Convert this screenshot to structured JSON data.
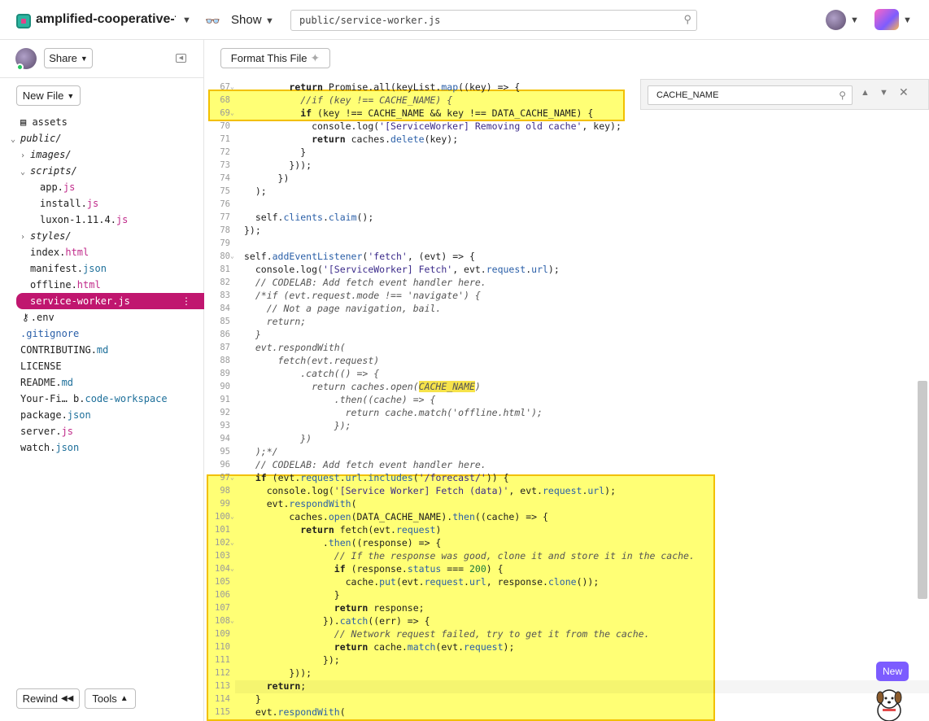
{
  "header": {
    "project_name": "amplified-cooperative-t…",
    "show_label": "Show",
    "url": "public/service-worker.js"
  },
  "sidebar": {
    "share_label": "Share",
    "new_file_label": "New File",
    "rewind_label": "Rewind",
    "tools_label": "Tools",
    "tree": [
      {
        "name": "assets",
        "ext": "",
        "indent": 0,
        "kind": "assets"
      },
      {
        "name": "public/",
        "ext": "",
        "indent": 0,
        "kind": "folder-open"
      },
      {
        "name": "images/",
        "ext": "",
        "indent": 1,
        "kind": "folder-closed"
      },
      {
        "name": "scripts/",
        "ext": "",
        "indent": 1,
        "kind": "folder-open"
      },
      {
        "name": "app.",
        "ext": "js",
        "indent": 2,
        "kind": "file"
      },
      {
        "name": "install.",
        "ext": "js",
        "indent": 2,
        "kind": "file"
      },
      {
        "name": "luxon-1.11.4.",
        "ext": "js",
        "indent": 2,
        "kind": "file"
      },
      {
        "name": "styles/",
        "ext": "",
        "indent": 1,
        "kind": "folder-closed"
      },
      {
        "name": "index.",
        "ext": "html",
        "indent": 1,
        "kind": "file"
      },
      {
        "name": "manifest.",
        "ext": "json",
        "indent": 1,
        "kind": "file"
      },
      {
        "name": "offline.",
        "ext": "html",
        "indent": 1,
        "kind": "file"
      },
      {
        "name": "service-worker.",
        "ext": "js",
        "indent": 1,
        "kind": "active"
      },
      {
        "name": ".env",
        "ext": "",
        "indent": 1,
        "kind": "env"
      },
      {
        "name": ".gitignore",
        "ext": "",
        "indent": 0,
        "kind": "gitignore"
      },
      {
        "name": "CONTRIBUTING.",
        "ext": "md",
        "indent": 0,
        "kind": "file"
      },
      {
        "name": "LICENSE",
        "ext": "",
        "indent": 0,
        "kind": "file"
      },
      {
        "name": "README.",
        "ext": "md",
        "indent": 0,
        "kind": "file"
      },
      {
        "name": "Your-Fi… b.",
        "ext": "code-workspace",
        "indent": 0,
        "kind": "file"
      },
      {
        "name": "package.",
        "ext": "json",
        "indent": 0,
        "kind": "file"
      },
      {
        "name": "server.",
        "ext": "js",
        "indent": 0,
        "kind": "file"
      },
      {
        "name": "watch.",
        "ext": "json",
        "indent": 0,
        "kind": "file"
      }
    ]
  },
  "editor": {
    "format_label": "Format This File",
    "find_query": "CACHE_NAME",
    "new_badge": "New",
    "lines": [
      {
        "n": "67",
        "fold": true,
        "html": "        <span class=\"kw\">return</span> Promise.all(keyList.<span class=\"fn\">map</span>((key) => {"
      },
      {
        "n": "68",
        "fold": false,
        "html": "          <span class=\"cm\">//if (key !== CACHE_NAME) {</span>"
      },
      {
        "n": "69",
        "fold": true,
        "html": "          <span class=\"kw\">if</span> (key !== CACHE_NAME && key !== DATA_CACHE_NAME) {"
      },
      {
        "n": "70",
        "fold": false,
        "html": "            console.log(<span class=\"str\">'[ServiceWorker] Removing old cache'</span>, key);"
      },
      {
        "n": "71",
        "fold": false,
        "html": "            <span class=\"kw\">return</span> caches.<span class=\"fn\">delete</span>(key);"
      },
      {
        "n": "72",
        "fold": false,
        "html": "          }"
      },
      {
        "n": "73",
        "fold": false,
        "html": "        }));"
      },
      {
        "n": "74",
        "fold": false,
        "html": "      })"
      },
      {
        "n": "75",
        "fold": false,
        "html": "  );"
      },
      {
        "n": "76",
        "fold": false,
        "html": ""
      },
      {
        "n": "77",
        "fold": false,
        "html": "  self.<span class=\"fn\">clients</span>.<span class=\"fn\">claim</span>();"
      },
      {
        "n": "78",
        "fold": false,
        "html": "});"
      },
      {
        "n": "79",
        "fold": false,
        "html": ""
      },
      {
        "n": "80",
        "fold": true,
        "html": "self.<span class=\"fn\">addEventListener</span>(<span class=\"str\">'fetch'</span>, (evt) => {"
      },
      {
        "n": "81",
        "fold": false,
        "html": "  console.log(<span class=\"str\">'[ServiceWorker] Fetch'</span>, evt.<span class=\"fn\">request</span>.<span class=\"fn\">url</span>);"
      },
      {
        "n": "82",
        "fold": false,
        "html": "  <span class=\"cm\">// CODELAB: Add fetch event handler here.</span>"
      },
      {
        "n": "83",
        "fold": false,
        "html": "  <span class=\"cm\">/*if (evt.request.mode !== 'navigate') {</span>"
      },
      {
        "n": "84",
        "fold": false,
        "html": "  <span class=\"cm\">  // Not a page navigation, bail.</span>"
      },
      {
        "n": "85",
        "fold": false,
        "html": "  <span class=\"cm\">  return;</span>"
      },
      {
        "n": "86",
        "fold": false,
        "html": "  <span class=\"cm\">}</span>"
      },
      {
        "n": "87",
        "fold": false,
        "html": "  <span class=\"cm\">evt.respondWith(</span>"
      },
      {
        "n": "88",
        "fold": false,
        "html": "  <span class=\"cm\">    fetch(evt.request)</span>"
      },
      {
        "n": "89",
        "fold": false,
        "html": "  <span class=\"cm\">        .catch(() => {</span>"
      },
      {
        "n": "90",
        "fold": false,
        "html": "  <span class=\"cm\">          return caches.open(<span class=\"match\">CACHE_NAME</span>)</span>"
      },
      {
        "n": "91",
        "fold": false,
        "html": "  <span class=\"cm\">              .then((cache) => {</span>"
      },
      {
        "n": "92",
        "fold": false,
        "html": "  <span class=\"cm\">                return cache.match('offline.html');</span>"
      },
      {
        "n": "93",
        "fold": false,
        "html": "  <span class=\"cm\">              });</span>"
      },
      {
        "n": "94",
        "fold": false,
        "html": "  <span class=\"cm\">        })</span>"
      },
      {
        "n": "95",
        "fold": false,
        "html": "  <span class=\"cm\">);*/</span>"
      },
      {
        "n": "96",
        "fold": false,
        "html": "  <span class=\"cm\">// CODELAB: Add fetch event handler here.</span>"
      },
      {
        "n": "97",
        "fold": true,
        "html": "  <span class=\"kw\">if</span> (evt.<span class=\"fn\">request</span>.<span class=\"fn\">url</span>.<span class=\"fn\">includes</span>(<span class=\"str\">'/forecast/'</span>)) {"
      },
      {
        "n": "98",
        "fold": false,
        "html": "    console.log(<span class=\"str\">'[Service Worker] Fetch (data)'</span>, evt.<span class=\"fn\">request</span>.<span class=\"fn\">url</span>);"
      },
      {
        "n": "99",
        "fold": false,
        "html": "    evt.<span class=\"fn\">respondWith</span>("
      },
      {
        "n": "100",
        "fold": true,
        "html": "        caches.<span class=\"fn\">open</span>(DATA_CACHE_NAME).<span class=\"fn\">then</span>((cache) => {"
      },
      {
        "n": "101",
        "fold": false,
        "html": "          <span class=\"kw\">return</span> fetch(evt.<span class=\"fn\">request</span>)"
      },
      {
        "n": "102",
        "fold": true,
        "html": "              .<span class=\"fn\">then</span>((response) => {"
      },
      {
        "n": "103",
        "fold": false,
        "html": "                <span class=\"cm\">// If the response was good, clone it and store it in the cache.</span>"
      },
      {
        "n": "104",
        "fold": true,
        "html": "                <span class=\"kw\">if</span> (response.<span class=\"fn\">status</span> === <span class=\"num\">200</span>) {"
      },
      {
        "n": "105",
        "fold": false,
        "html": "                  cache.<span class=\"fn\">put</span>(evt.<span class=\"fn\">request</span>.<span class=\"fn\">url</span>, response.<span class=\"fn\">clone</span>());"
      },
      {
        "n": "106",
        "fold": false,
        "html": "                }"
      },
      {
        "n": "107",
        "fold": false,
        "html": "                <span class=\"kw\">return</span> response;"
      },
      {
        "n": "108",
        "fold": true,
        "html": "              }).<span class=\"fn\">catch</span>((err) => {"
      },
      {
        "n": "109",
        "fold": false,
        "html": "                <span class=\"cm\">// Network request failed, try to get it from the cache.</span>"
      },
      {
        "n": "110",
        "fold": false,
        "html": "                <span class=\"kw\">return</span> cache.<span class=\"fn\">match</span>(evt.<span class=\"fn\">request</span>);"
      },
      {
        "n": "111",
        "fold": false,
        "html": "              });"
      },
      {
        "n": "112",
        "fold": false,
        "html": "        }));"
      },
      {
        "n": "113",
        "fold": false,
        "html": "    <span class=\"kw\">return</span>;"
      },
      {
        "n": "114",
        "fold": false,
        "html": "  }"
      },
      {
        "n": "115",
        "fold": false,
        "html": "  evt.<span class=\"fn\">respondWith</span>("
      }
    ]
  }
}
